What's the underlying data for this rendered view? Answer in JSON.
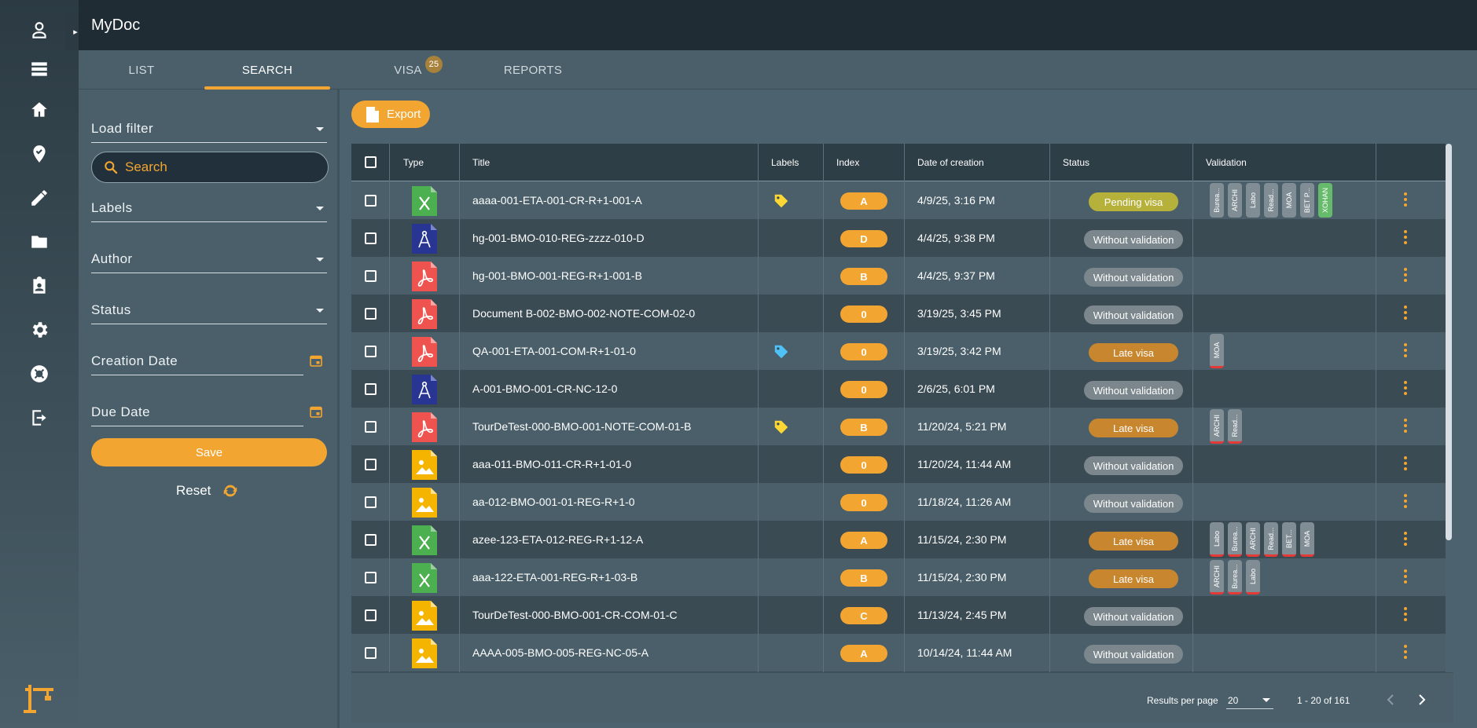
{
  "app": {
    "title": "MyDoc"
  },
  "rail": {
    "icons": [
      "user-icon",
      "list-icon",
      "home-icon",
      "map-pin-check-icon",
      "pencil-icon",
      "folder-icon",
      "clipboard-user-icon",
      "gear-icon",
      "lifebuoy-icon",
      "logout-icon",
      "crane-icon"
    ]
  },
  "tabs": [
    {
      "label": "LIST"
    },
    {
      "label": "SEARCH",
      "active": true
    },
    {
      "label": "VISA",
      "badge": "25"
    },
    {
      "label": "REPORTS"
    }
  ],
  "filters": {
    "load_filter": "Load filter",
    "search_placeholder": "Search",
    "labels": "Labels",
    "author": "Author",
    "status": "Status",
    "creation_date": "Creation Date",
    "due_date": "Due Date",
    "save": "Save",
    "reset": "Reset"
  },
  "toolbar": {
    "export": "Export"
  },
  "table": {
    "headers": {
      "type": "Type",
      "title": "Title",
      "labels": "Labels",
      "index": "Index",
      "date": "Date of creation",
      "status": "Status",
      "validation": "Validation"
    },
    "rows": [
      {
        "type": "excel",
        "title": "aaaa-001-ETA-001-CR-R+1-001-A",
        "label": "yellow",
        "index": "A",
        "date": "4/9/25, 3:16 PM",
        "status": "Pending visa",
        "status_kind": "pending",
        "validation": [
          {
            "text": "Burea...",
            "kind": "grey"
          },
          {
            "text": "ARCHI",
            "kind": "grey"
          },
          {
            "text": "Labo",
            "kind": "grey"
          },
          {
            "text": "Read...",
            "kind": "grey"
          },
          {
            "text": "MOA",
            "kind": "grey"
          },
          {
            "text": "BET P...",
            "kind": "grey"
          },
          {
            "text": "XOHAN",
            "kind": "green"
          }
        ]
      },
      {
        "type": "cad",
        "title": "hg-001-BMO-010-REG-zzzz-010-D",
        "label": "",
        "index": "D",
        "date": "4/4/25, 9:38 PM",
        "status": "Without validation",
        "status_kind": "none",
        "validation": []
      },
      {
        "type": "pdf",
        "title": "hg-001-BMO-001-REG-R+1-001-B",
        "label": "",
        "index": "B",
        "date": "4/4/25, 9:37 PM",
        "status": "Without validation",
        "status_kind": "none",
        "validation": []
      },
      {
        "type": "pdf",
        "title": "Document B-002-BMO-002-NOTE-COM-02-0",
        "label": "",
        "index": "0",
        "date": "3/19/25, 3:45 PM",
        "status": "Without validation",
        "status_kind": "none",
        "validation": []
      },
      {
        "type": "pdf",
        "title": "QA-001-ETA-001-COM-R+1-01-0",
        "label": "blue",
        "index": "0",
        "date": "3/19/25, 3:42 PM",
        "status": "Late visa",
        "status_kind": "late",
        "validation": [
          {
            "text": "MOA",
            "kind": "red"
          }
        ]
      },
      {
        "type": "cad",
        "title": "A-001-BMO-001-CR-NC-12-0",
        "label": "",
        "index": "0",
        "date": "2/6/25, 6:01 PM",
        "status": "Without validation",
        "status_kind": "none",
        "validation": []
      },
      {
        "type": "pdf",
        "title": "TourDeTest-000-BMO-001-NOTE-COM-01-B",
        "label": "yellow",
        "index": "B",
        "date": "11/20/24, 5:21 PM",
        "status": "Late visa",
        "status_kind": "late",
        "validation": [
          {
            "text": "ARCHI",
            "kind": "red"
          },
          {
            "text": "Read...",
            "kind": "red"
          }
        ]
      },
      {
        "type": "image",
        "title": "aaa-011-BMO-011-CR-R+1-01-0",
        "label": "",
        "index": "0",
        "date": "11/20/24, 11:44 AM",
        "status": "Without validation",
        "status_kind": "none",
        "validation": []
      },
      {
        "type": "image",
        "title": "aa-012-BMO-001-01-REG-R+1-0",
        "label": "",
        "index": "0",
        "date": "11/18/24, 11:26 AM",
        "status": "Without validation",
        "status_kind": "none",
        "validation": []
      },
      {
        "type": "excel",
        "title": "azee-123-ETA-012-REG-R+1-12-A",
        "label": "",
        "index": "A",
        "date": "11/15/24, 2:30 PM",
        "status": "Late visa",
        "status_kind": "late",
        "validation": [
          {
            "text": "Labo",
            "kind": "red"
          },
          {
            "text": "Burea...",
            "kind": "red"
          },
          {
            "text": "ARCHI",
            "kind": "red"
          },
          {
            "text": "Read...",
            "kind": "red"
          },
          {
            "text": "BET...",
            "kind": "red"
          },
          {
            "text": "MOA",
            "kind": "red"
          }
        ]
      },
      {
        "type": "excel",
        "title": "aaa-122-ETA-001-REG-R+1-03-B",
        "label": "",
        "index": "B",
        "date": "11/15/24, 2:30 PM",
        "status": "Late visa",
        "status_kind": "late",
        "validation": [
          {
            "text": "ARCHI",
            "kind": "red"
          },
          {
            "text": "Burea...",
            "kind": "red"
          },
          {
            "text": "Labo",
            "kind": "red"
          }
        ]
      },
      {
        "type": "image",
        "title": "TourDeTest-000-BMO-001-CR-COM-01-C",
        "label": "",
        "index": "C",
        "date": "11/13/24, 2:45 PM",
        "status": "Without validation",
        "status_kind": "none",
        "validation": []
      },
      {
        "type": "image",
        "title": "AAAA-005-BMO-005-REG-NC-05-A",
        "label": "",
        "index": "A",
        "date": "10/14/24, 11:44 AM",
        "status": "Without validation",
        "status_kind": "none",
        "validation": []
      },
      {
        "type": "image",
        "title": "",
        "label": "",
        "index": "",
        "date": "",
        "status": "",
        "status_kind": "",
        "validation": []
      }
    ]
  },
  "pagination": {
    "rpp_label": "Results per page",
    "rpp_value": "20",
    "range": "1 - 20 of 161"
  },
  "colors": {
    "accent": "#f2a531",
    "pending": "#b5b13a",
    "late": "#c8872f",
    "none": "#7b878d",
    "excel": "#4caf50",
    "pdf": "#ef5350",
    "cad": "#283593",
    "image": "#f4b400",
    "tag_yellow": "#fdd835",
    "tag_blue": "#4fc3f7"
  }
}
